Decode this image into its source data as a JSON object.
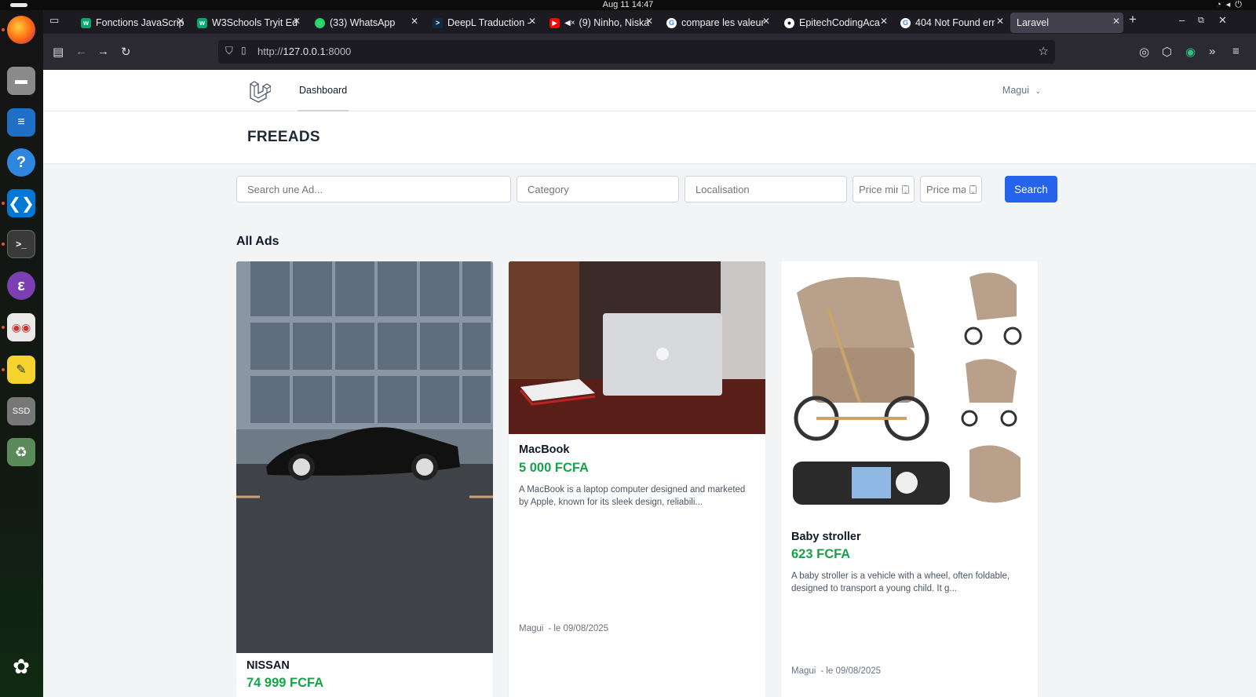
{
  "system": {
    "clock": "Aug 11  14:47"
  },
  "dock": {
    "items": [
      "Firefox",
      "Files",
      "Writer",
      "Help",
      "VS Code",
      "Terminal",
      "Emacs",
      "Document Viewer",
      "Text Editor",
      "SSD",
      "Trash",
      "Show Apps"
    ]
  },
  "browser": {
    "tabs": [
      {
        "label": "Fonctions JavaScrip",
        "icon": "w3schools-icon"
      },
      {
        "label": "W3Schools Tryit Ed",
        "icon": "w3schools-icon"
      },
      {
        "label": "(33) WhatsApp",
        "icon": "whatsapp-icon"
      },
      {
        "label": "DeepL Traduction -",
        "icon": "deepl-icon"
      },
      {
        "label": "(9) Ninho, Niska",
        "icon": "youtube-icon"
      },
      {
        "label": "compare les valeur",
        "icon": "google-icon"
      },
      {
        "label": "EpitechCodingAca",
        "icon": "github-icon"
      },
      {
        "label": "404 Not Found err",
        "icon": "google-icon"
      },
      {
        "label": "Laravel",
        "icon": ""
      }
    ],
    "url_prefix": "http://",
    "url_host": "127.0.0.1",
    "url_port": ":8000"
  },
  "app": {
    "nav_link": "Dashboard",
    "user": "Magui",
    "page_title": "FREEADS"
  },
  "search": {
    "query_placeholder": "Search une Ad...",
    "category_placeholder": "Category",
    "location_placeholder": "Localisation",
    "price_min_placeholder": "Price min",
    "price_max_placeholder": "Price max",
    "button": "Search"
  },
  "ads": {
    "section_title": "All Ads",
    "items": [
      {
        "title": "NISSAN",
        "price": "74 999 FCFA",
        "description": "",
        "author": "",
        "date": ""
      },
      {
        "title": "MacBook",
        "price": "5 000 FCFA",
        "description": "A MacBook is a laptop computer designed and marketed by Apple, known for its sleek design, reliabili...",
        "author": "Magui",
        "date": "- le  09/08/2025"
      },
      {
        "title": "Baby stroller",
        "price": "623 FCFA",
        "description": "A baby stroller is a vehicle with a wheel, often foldable, designed to transport a young child. It g...",
        "author": "Magui",
        "date": "- le  09/08/2025"
      }
    ]
  },
  "colors": {
    "primary": "#2563eb",
    "price": "#16a34a",
    "page_bg": "#f3f4f6"
  }
}
